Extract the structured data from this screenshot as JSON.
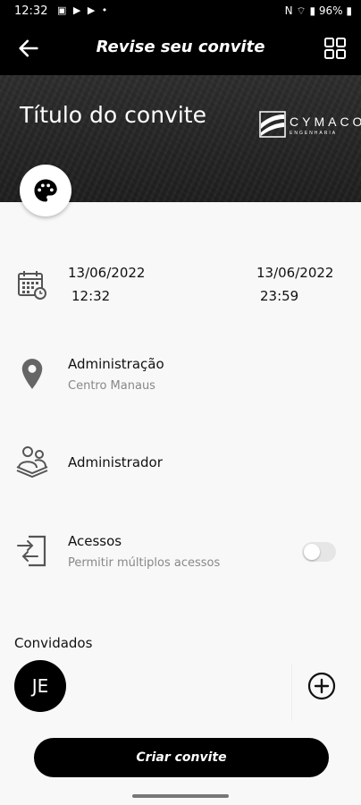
{
  "status_bar": {
    "time": "12:32",
    "notifications": "▣ ▶ ▶ •",
    "right": "N ⌔ ▮ 96% ▮"
  },
  "app_bar": {
    "back_icon": "arrow-left-icon",
    "title": "Revise seu convite",
    "grid_icon": "grid-icon"
  },
  "banner": {
    "title": "Título do convite",
    "logo_name": "CYMACO",
    "logo_sub": "ENGENHARIA"
  },
  "palette_icon": "palette-icon",
  "schedule": {
    "start_date": "13/06/2022",
    "start_time": "12:32",
    "end_date": "13/06/2022",
    "end_time": "23:59",
    "icon": "calendar-icon"
  },
  "location": {
    "name": "Administração",
    "detail": "Centro Manaus",
    "icon": "location-pin-icon"
  },
  "host": {
    "name": "Administrador",
    "icon": "people-icon"
  },
  "access": {
    "title": "Acessos",
    "subtitle": "Permitir múltiplos acessos",
    "icon": "login-icon",
    "multiple_enabled": false
  },
  "guests": {
    "label": "Convidados",
    "items": [
      {
        "initials": "JE"
      }
    ],
    "add_icon": "plus-circle-icon"
  },
  "create_button": {
    "label": "Criar convite"
  }
}
